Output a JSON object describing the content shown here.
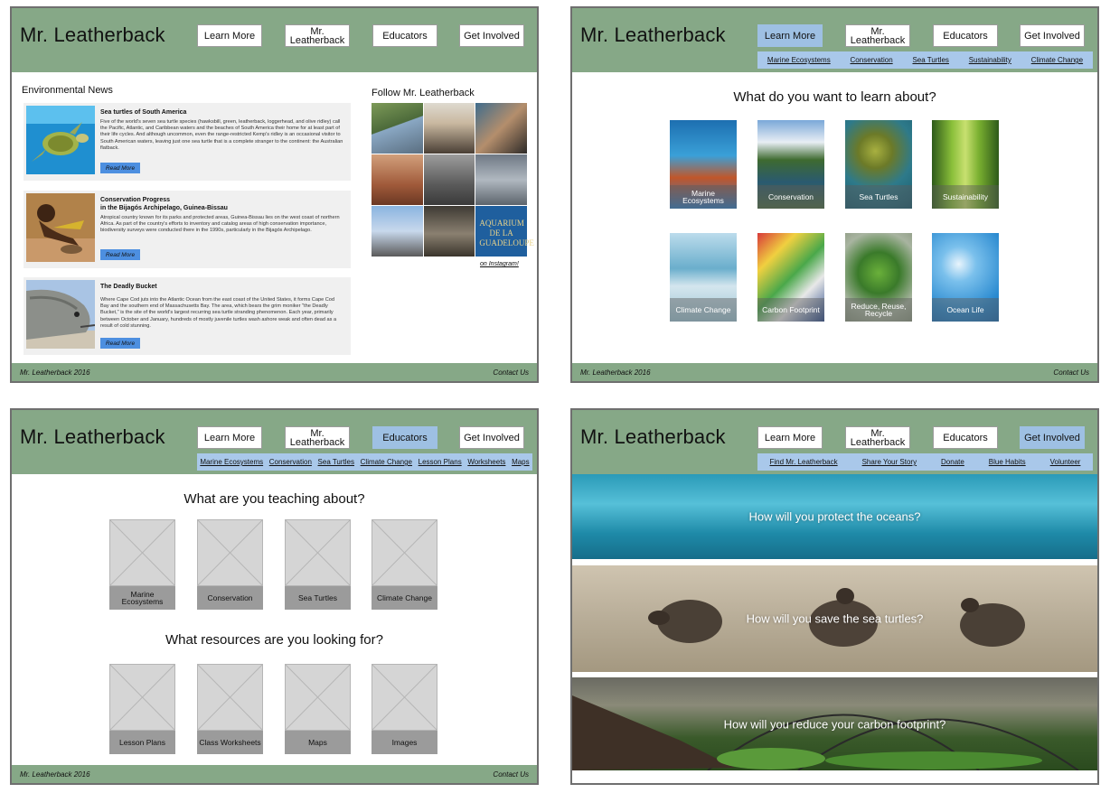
{
  "site": {
    "logo": "Mr. Leatherback"
  },
  "nav": {
    "learn": "Learn More",
    "about": "Mr. Leatherback",
    "educators": "Educators",
    "involved": "Get Involved"
  },
  "footer": {
    "left": "Mr. Leatherback 2016",
    "right": "Contact Us"
  },
  "colors": {
    "header": "#86a887",
    "active_nav": "#9ec0e3",
    "subnav": "#a9c8ea",
    "read_more": "#4d8fe0"
  },
  "home": {
    "news_title": "Environmental News",
    "articles": [
      {
        "title": "Sea turtles of South America",
        "body": "Five of the world's seven sea turtle species (hawksbill, green, leatherback, loggerhead, and olive ridley) call the Pacific, Atlantic, and Caribbean waters and the beaches of South America their home for at least part of their life cycles. And although uncommon, even the range-restricted Kemp's ridley is an occasional visitor to South American waters, leaving just one sea turtle that is a complete stranger to the continent: the Australian flatback.",
        "cta": "Read More"
      },
      {
        "title": "Conservation Progress",
        "subtitle": "in the Bijagós Archipelago, Guinea-Bissau",
        "body": "Atropical country known for its parks and protected areas, Guinea-Bissau lies on the west coast of northern Africa. As part of the country's efforts to inventory and catalog areas of high conservation importance, biodiversity surveys were conducted there in the 1990s, particularly in the Bijagós Archipelago.",
        "cta": "Read More"
      },
      {
        "title": "The Deadly Bucket",
        "body": "Where Cape Cod juts into the Atlantic Ocean from the east coast of the United States, it forms Cape Cod Bay and the southern end of Massachusetts Bay. The area, which bears the grim moniker \"the Deadly Bucket,\" is the site of the world's largest recurring sea turtle stranding phenomenon. Each year, primarily between October and January, hundreds of mostly juvenile turtles wash ashore weak and often dead as a result of cold stunning.",
        "cta": "Read More"
      }
    ],
    "follow_title": "Follow Mr. Leatherback",
    "instagram_sign": "AQUARIUM DE LA GUADELOUPE",
    "instagram_link": "on Instagram!"
  },
  "learn": {
    "subnav": [
      "Marine Ecosystems",
      "Conservation",
      "Sea Turtles",
      "Sustainability",
      "Climate Change"
    ],
    "heading": "What do you want to learn about?",
    "topics": [
      "Marine Ecosystems",
      "Conservation",
      "Sea Turtles",
      "Sustainability",
      "Climate Change",
      "Carbon Footprint",
      "Reduce, Reuse, Recycle",
      "Ocean Life"
    ]
  },
  "educators": {
    "subnav": [
      "Marine Ecosystems",
      "Conservation",
      "Sea Turtles",
      "Climate Change",
      "Lesson Plans",
      "Worksheets",
      "Maps"
    ],
    "heading1": "What are you teaching about?",
    "topics": [
      "Marine Ecosystems",
      "Conservation",
      "Sea Turtles",
      "Climate Change"
    ],
    "heading2": "What resources are you looking for?",
    "resources": [
      "Lesson Plans",
      "Class Worksheets",
      "Maps",
      "Images"
    ]
  },
  "involved": {
    "subnav": [
      "Find Mr. Leatherback",
      "Share Your Story",
      "Donate",
      "Blue Habits",
      "Volunteer"
    ],
    "bands": [
      "How will you protect the oceans?",
      "How will you save the sea turtles?",
      "How will you reduce your carbon footprint?"
    ]
  }
}
